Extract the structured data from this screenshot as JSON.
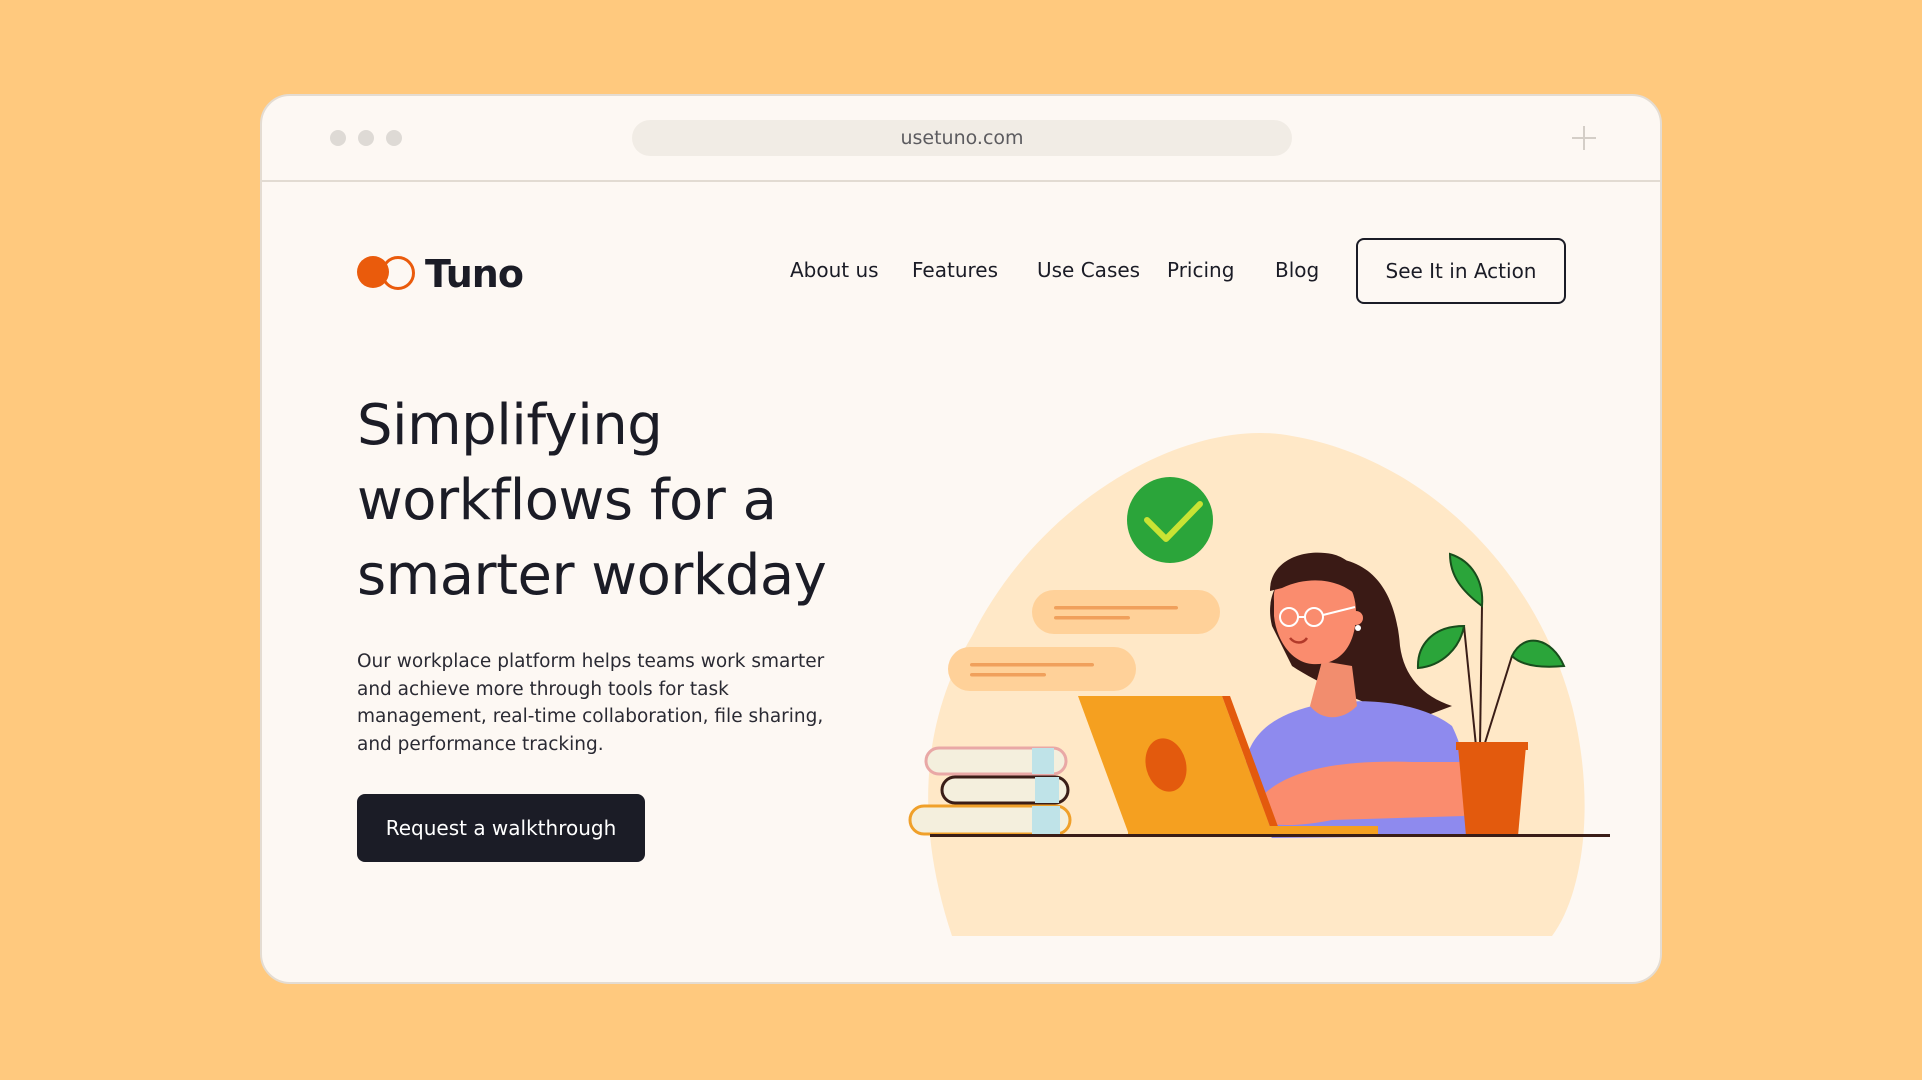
{
  "browser": {
    "url": "usetuno.com"
  },
  "header": {
    "logo_text": "Tuno",
    "nav": [
      "About us",
      "Features",
      "Use Cases",
      "Pricing",
      "Blog"
    ],
    "cta": "See It in Action"
  },
  "hero": {
    "headline": [
      "Simplifying",
      "workflows for a",
      "smarter workday"
    ],
    "description": "Our workplace platform helps teams work smarter and achieve more through tools for task management, real-time collaboration, file sharing, and performance tracking.",
    "cta": "Request a walkthrough"
  },
  "colors": {
    "page_background": "#FFC97E",
    "brand_orange": "#EA5B0C",
    "dark": "#1B1C26",
    "card_background": "#FDF8F3",
    "check_green": "#2BA53A",
    "shirt_purple": "#8E8AEE"
  },
  "icons": [
    "logo-mark-icon",
    "checkmark-icon",
    "plus-icon"
  ]
}
